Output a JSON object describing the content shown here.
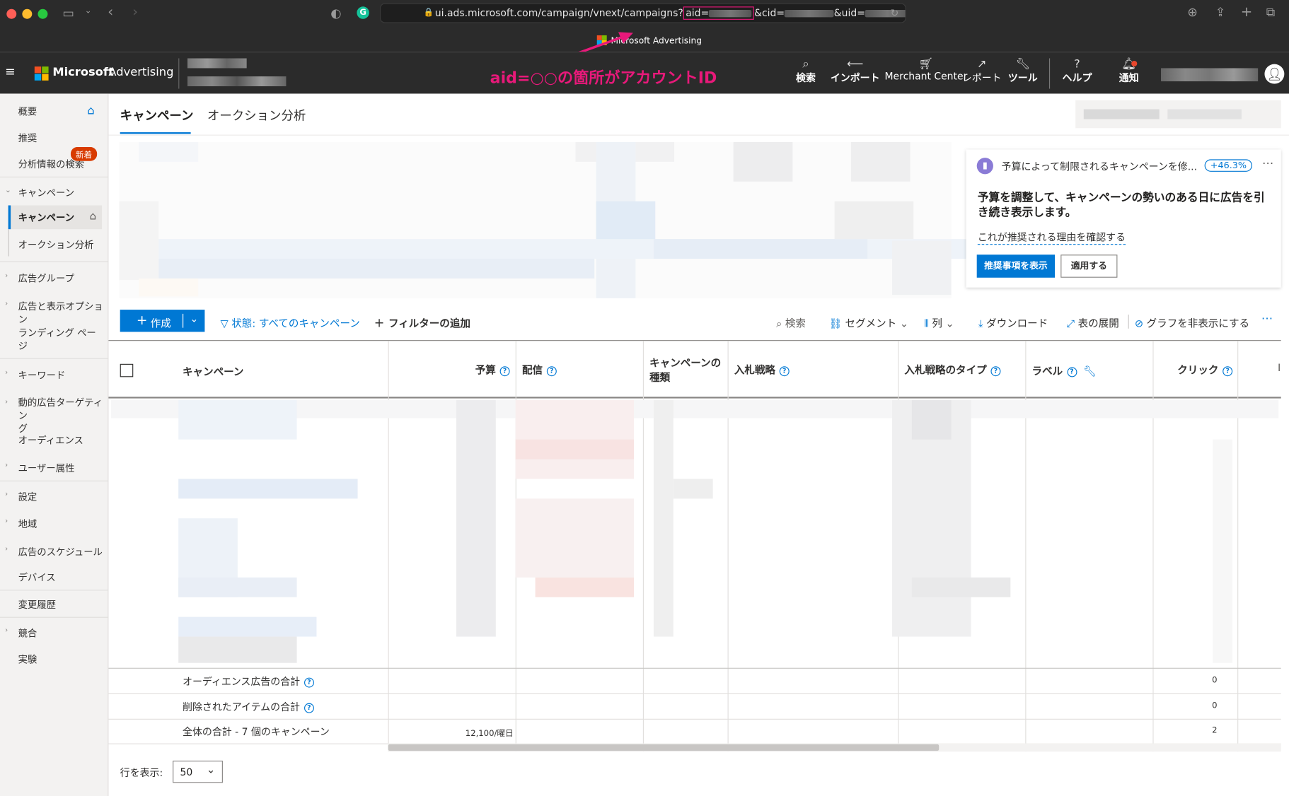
{
  "browser": {
    "url_prefix": "ui.ads.microsoft.com/campaign/vnext/campaigns?",
    "url_aid": "aid=",
    "url_cid": "&cid=",
    "url_uid": "&uid=",
    "page_title": "Microsoft Advertising"
  },
  "annotation": {
    "text": "aid=○○の箇所がアカウントID",
    "color": "#e8197a"
  },
  "header": {
    "brand_microsoft": "Microsoft",
    "brand_advertising": "Advertising",
    "nav": [
      {
        "label": "検索",
        "icon": "search-icon"
      },
      {
        "label": "インポート",
        "icon": "import-icon"
      },
      {
        "label": "Merchant Center",
        "icon": "cart-icon"
      },
      {
        "label": "レポート",
        "icon": "chart-icon"
      },
      {
        "label": "ツール",
        "icon": "wrench-icon"
      },
      {
        "label": "ヘルプ",
        "icon": "help-icon"
      },
      {
        "label": "通知",
        "icon": "bell-icon"
      }
    ]
  },
  "sidebar": {
    "overview": "概要",
    "recommendations": "推奨",
    "insights": "分析情報の検索",
    "new_badge": "新着",
    "campaigns_group": "キャンペーン",
    "campaigns": "キャンペーン",
    "auction": "オークション分析",
    "adgroups": "広告グループ",
    "ads_ext": "広告と表示オプション",
    "landing_1": "ランディング ペー",
    "landing_2": "ジ",
    "keywords": "キーワード",
    "dsa_1": "動的広告ターゲティン",
    "dsa_2": "グ",
    "audiences": "オーディエンス",
    "demographics": "ユーザー属性",
    "settings": "設定",
    "locations": "地域",
    "schedule": "広告のスケジュール",
    "devices": "デバイス",
    "history": "変更履歴",
    "competition": "競合",
    "experiments": "実験"
  },
  "tabs": {
    "campaigns": "キャンペーン",
    "auction": "オークション分析"
  },
  "recommendation": {
    "title": "予算によって制限されるキャンペーンを修...",
    "badge": "+46.3%",
    "body": "予算を調整して、キャンペーンの勢いのある日に広告を引き続き表示します。",
    "link": "これが推奨される理由を確認する",
    "primary_button": "推奨事項を表示",
    "secondary_button": "適用する",
    "accent": "#0078d4"
  },
  "toolbar": {
    "create": "作成",
    "filter": "状態: すべてのキャンペーン",
    "add_filter": "フィルターの追加",
    "search": "検索",
    "segment": "セグメント",
    "columns": "列",
    "download": "ダウンロード",
    "expand": "表の展開",
    "hide_chart": "グラフを非表示にする"
  },
  "table": {
    "headers": {
      "campaign": "キャンペーン",
      "budget": "予算",
      "delivery": "配信",
      "type_1": "キャンペーンの",
      "type_2": "種類",
      "bid_strategy": "入札戦略",
      "bid_type": "入札戦略のタイプ",
      "labels": "ラベル",
      "clicks": "クリック",
      "next": "I"
    },
    "totals": [
      {
        "label": "オーディエンス広告の合計",
        "budget": "",
        "clicks": "0"
      },
      {
        "label": "削除されたアイテムの合計",
        "budget": "",
        "clicks": "0"
      },
      {
        "label": "全体の合計 - 7 個のキャンペーン",
        "budget": "12,100/曜日",
        "clicks": "2"
      }
    ]
  },
  "footer": {
    "rows_label": "行を表示:",
    "rows_value": "50"
  }
}
